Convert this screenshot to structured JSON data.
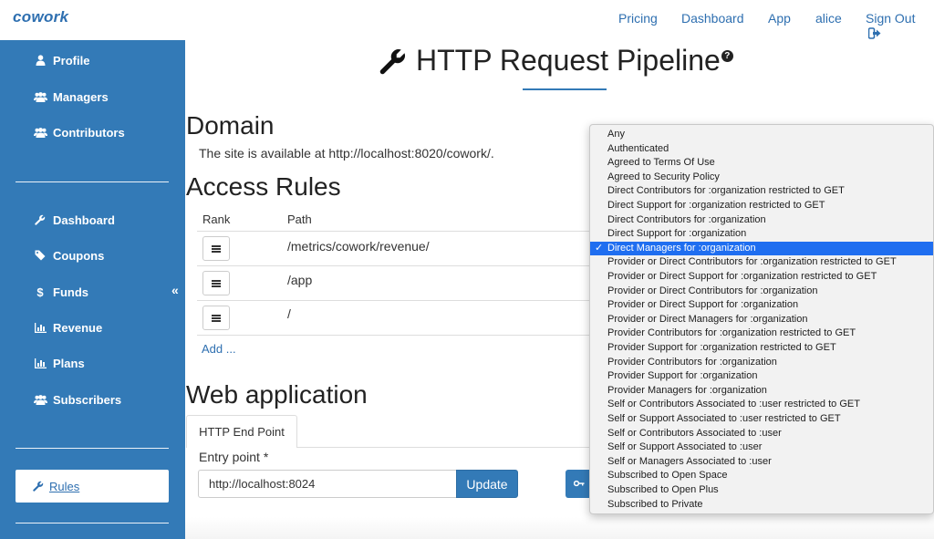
{
  "brand": {
    "logo": "cowork"
  },
  "topnav": {
    "items": [
      "Pricing",
      "Dashboard",
      "App",
      "alice",
      "Sign Out"
    ]
  },
  "sidebar": {
    "items": [
      {
        "label": "Profile",
        "icon": "user-icon"
      },
      {
        "label": "Managers",
        "icon": "users-icon"
      },
      {
        "label": "Contributors",
        "icon": "users-icon"
      },
      {
        "label": "Dashboard",
        "icon": "wrench-icon"
      },
      {
        "label": "Coupons",
        "icon": "tag-icon"
      },
      {
        "label": "Funds",
        "icon": "dollar-icon"
      },
      {
        "label": "Revenue",
        "icon": "bar-chart-icon"
      },
      {
        "label": "Plans",
        "icon": "bar-chart-icon"
      },
      {
        "label": "Subscribers",
        "icon": "users-icon"
      }
    ],
    "collapse_glyph": "«",
    "active": {
      "label": "Rules",
      "icon": "wrench-icon"
    }
  },
  "main": {
    "title": "HTTP Request Pipeline",
    "domain": {
      "heading": "Domain",
      "text": "The site is available at http://localhost:8020/cowork/."
    },
    "access_rules": {
      "heading": "Access Rules",
      "columns": [
        "Rank",
        "Path"
      ],
      "rows": [
        {
          "path": "/metrics/cowork/revenue/"
        },
        {
          "path": "/app"
        },
        {
          "path": "/"
        }
      ],
      "add_label": "Add ..."
    },
    "web_app": {
      "heading": "Web application",
      "tab": "HTTP End Point",
      "entry_label": "Entry point *",
      "entry_value": "http://localhost:8024",
      "update_label": "Update"
    }
  },
  "dropdown": {
    "selected_index": 8,
    "check_glyph": "✓",
    "options": [
      "Any",
      "Authenticated",
      "Agreed to Terms Of Use",
      "Agreed to Security Policy",
      "Direct Contributors for :organization restricted to GET",
      "Direct Support for :organization restricted to GET",
      "Direct Contributors for :organization",
      "Direct Support for :organization",
      "Direct Managers for :organization",
      "Provider or Direct Contributors for :organization restricted to GET",
      "Provider or Direct Support for :organization restricted to GET",
      "Provider or Direct Contributors for :organization",
      "Provider or Direct Support for :organization",
      "Provider or Direct Managers for :organization",
      "Provider Contributors for :organization restricted to GET",
      "Provider Support for :organization restricted to GET",
      "Provider Contributors for :organization",
      "Provider Support for :organization",
      "Provider Managers for :organization",
      "Self or Contributors Associated to :user restricted to GET",
      "Self or Support Associated to :user restricted to GET",
      "Self or Contributors Associated to :user",
      "Self or Support Associated to :user",
      "Self or Managers Associated to :user",
      "Subscribed to Open Space",
      "Subscribed to Open Plus",
      "Subscribed to Private"
    ]
  },
  "colors": {
    "primary": "#337ab7",
    "link": "#2e6fb0",
    "selected": "#1f6ef0"
  }
}
